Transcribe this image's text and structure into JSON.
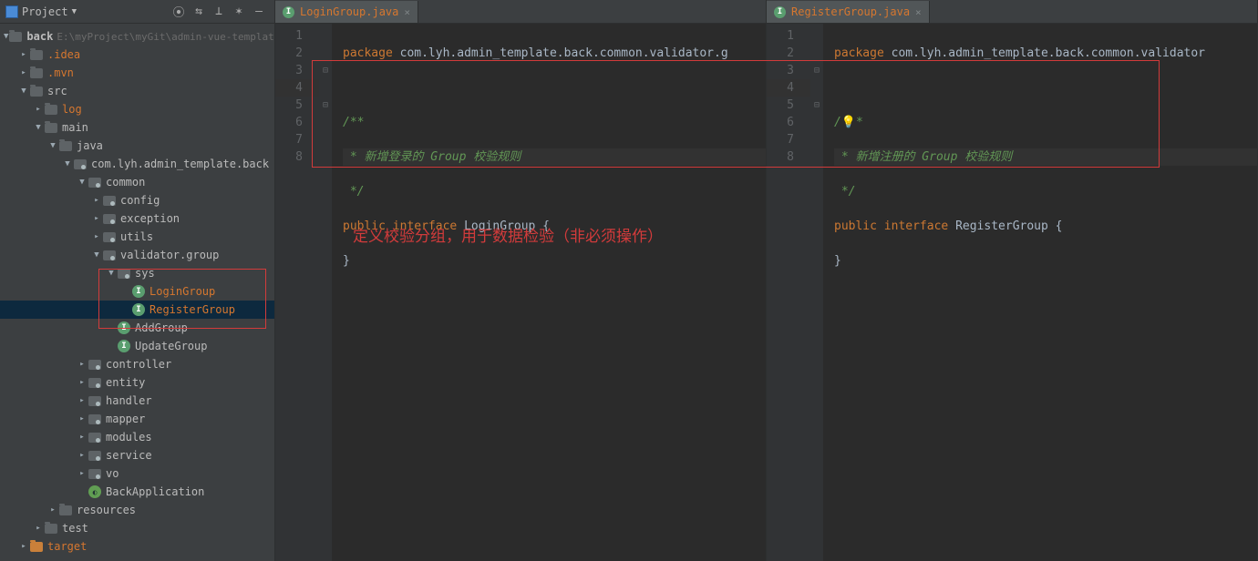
{
  "sidebar": {
    "title": "Project",
    "root": {
      "name": "back",
      "path": "E:\\myProject\\myGit\\admin-vue-template"
    },
    "items": {
      "idea": ".idea",
      "mvn": ".mvn",
      "src": "src",
      "log": "log",
      "main": "main",
      "java": "java",
      "pkgroot": "com.lyh.admin_template.back",
      "common": "common",
      "config": "config",
      "exception": "exception",
      "utils": "utils",
      "validatorgroup": "validator.group",
      "sys": "sys",
      "loginGroup": "LoginGroup",
      "registerGroup": "RegisterGroup",
      "addGroup": "AddGroup",
      "updateGroup": "UpdateGroup",
      "controller": "controller",
      "entity": "entity",
      "handler": "handler",
      "mapper": "mapper",
      "modules": "modules",
      "service": "service",
      "vo": "vo",
      "backApplication": "BackApplication",
      "resources": "resources",
      "test": "test",
      "target": "target"
    }
  },
  "tabs": {
    "left": "LoginGroup.java",
    "right": "RegisterGroup.java"
  },
  "left_code": {
    "l1_kw": "package ",
    "l1_rest": "com.lyh.admin_template.back.common.validator.g",
    "l2": "",
    "l3": "/**",
    "l4": " * 新增登录的 Group 校验规则",
    "l5": " */",
    "l6_kw1": "public ",
    "l6_kw2": "interface ",
    "l6_name": "LoginGroup {",
    "l7": "}",
    "l8": ""
  },
  "right_code": {
    "l1_kw": "package ",
    "l1_rest": "com.lyh.admin_template.back.common.validator",
    "l2": "",
    "l3a": "/",
    "l3b": "*",
    "l4": " * 新增注册的 Group 校验规则",
    "l5": " */",
    "l6_kw1": "public ",
    "l6_kw2": "interface ",
    "l6_name": "RegisterGroup {",
    "l7": "}",
    "l8": ""
  },
  "annotation": "定义校验分组，用于数据检验（非必须操作）"
}
